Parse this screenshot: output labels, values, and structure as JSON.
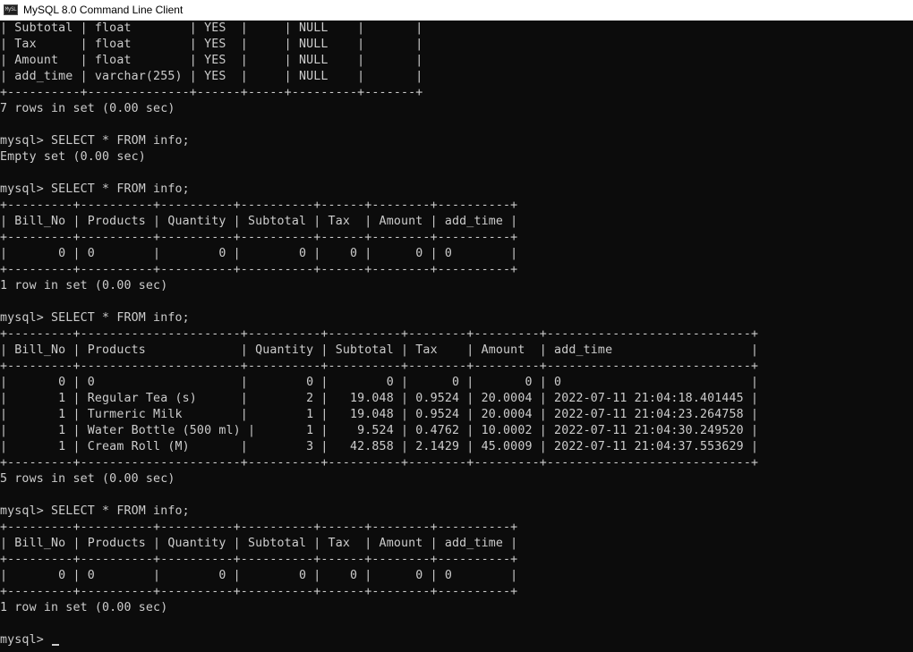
{
  "window": {
    "title": "MySQL 8.0 Command Line Client",
    "icon": "mysql-console-icon",
    "icon_text": "MySL"
  },
  "console": {
    "lines": [
      "| Subtotal | float        | YES  |     | NULL    |       |",
      "| Tax      | float        | YES  |     | NULL    |       |",
      "| Amount   | float        | YES  |     | NULL    |       |",
      "| add_time | varchar(255) | YES  |     | NULL    |       |",
      "+----------+--------------+------+-----+---------+-------+",
      "7 rows in set (0.00 sec)",
      "",
      "mysql> SELECT * FROM info;",
      "Empty set (0.00 sec)",
      "",
      "mysql> SELECT * FROM info;",
      "+---------+----------+----------+----------+------+--------+----------+",
      "| Bill_No | Products | Quantity | Subtotal | Tax  | Amount | add_time |",
      "+---------+----------+----------+----------+------+--------+----------+",
      "|       0 | 0        |        0 |        0 |    0 |      0 | 0        |",
      "+---------+----------+----------+----------+------+--------+----------+",
      "1 row in set (0.00 sec)",
      "",
      "mysql> SELECT * FROM info;",
      "+---------+----------------------+----------+----------+--------+---------+----------------------------+",
      "| Bill_No | Products             | Quantity | Subtotal | Tax    | Amount  | add_time                   |",
      "+---------+----------------------+----------+----------+--------+---------+----------------------------+",
      "|       0 | 0                    |        0 |        0 |      0 |       0 | 0                          |",
      "|       1 | Regular Tea (s)      |        2 |   19.048 | 0.9524 | 20.0004 | 2022-07-11 21:04:18.401445 |",
      "|       1 | Turmeric Milk        |        1 |   19.048 | 0.9524 | 20.0004 | 2022-07-11 21:04:23.264758 |",
      "|       1 | Water Bottle (500 ml) |       1 |    9.524 | 0.4762 | 10.0002 | 2022-07-11 21:04:30.249520 |",
      "|       1 | Cream Roll (M)       |        3 |   42.858 | 2.1429 | 45.0009 | 2022-07-11 21:04:37.553629 |",
      "+---------+----------------------+----------+----------+--------+---------+----------------------------+",
      "5 rows in set (0.00 sec)",
      "",
      "mysql> SELECT * FROM info;",
      "+---------+----------+----------+----------+------+--------+----------+",
      "| Bill_No | Products | Quantity | Subtotal | Tax  | Amount | add_time |",
      "+---------+----------+----------+----------+------+--------+----------+",
      "|       0 | 0        |        0 |        0 |    0 |      0 | 0        |",
      "+---------+----------+----------+----------+------+--------+----------+",
      "1 row in set (0.00 sec)",
      "",
      "mysql> "
    ]
  }
}
